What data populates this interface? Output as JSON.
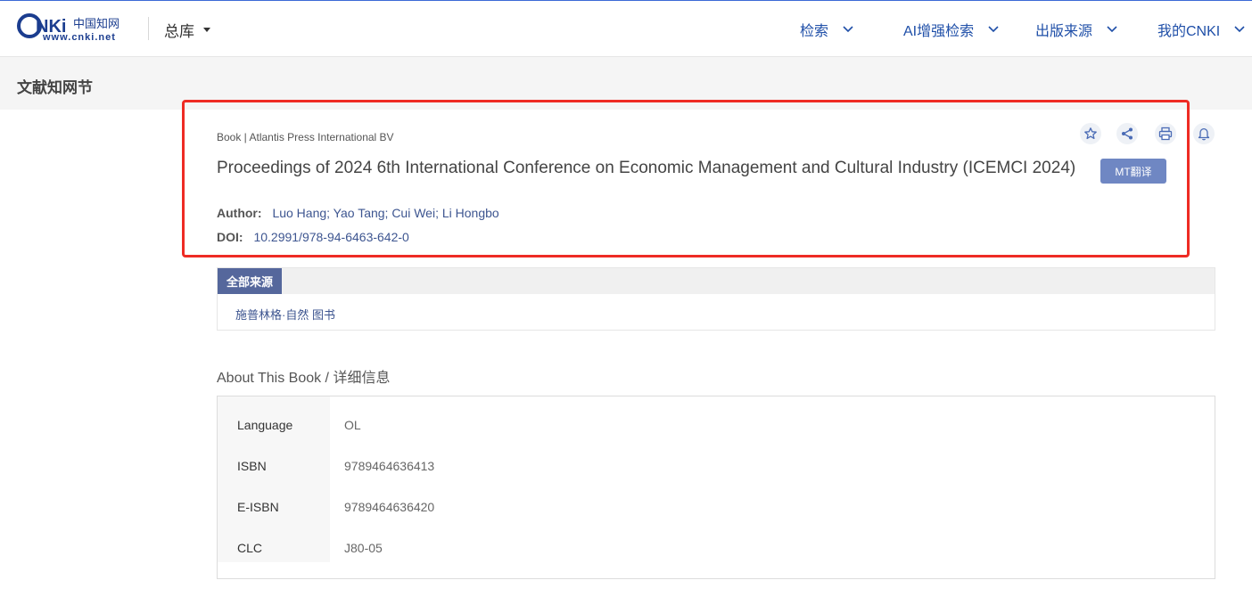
{
  "header": {
    "logo_text": "www.cnki.net",
    "library_label": "总库",
    "nav": [
      {
        "label": "检索"
      },
      {
        "label": "AI增强检索"
      },
      {
        "label": "出版来源"
      },
      {
        "label": "我的CNKI"
      }
    ]
  },
  "section": {
    "title": "文献知网节"
  },
  "book": {
    "meta": "Book | Atlantis Press International BV",
    "title": "Proceedings of 2024 6th International Conference on Economic Management and Cultural Industry (ICEMCI 2024)",
    "translate_button": "MT翻译",
    "author_label": "Author:",
    "authors": "Luo Hang; Yao Tang; Cui Wei; Li Hongbo",
    "doi_label": "DOI:",
    "doi": "10.2991/978-94-6463-642-0",
    "tools": [
      "star-icon",
      "share-icon",
      "print-icon",
      "bell-icon"
    ]
  },
  "sources": {
    "tab_label": "全部来源",
    "link": "施普林格·自然 图书"
  },
  "about": {
    "heading": "About This Book / 详细信息",
    "rows": [
      {
        "label": "Language",
        "value": "OL"
      },
      {
        "label": "ISBN",
        "value": "9789464636413"
      },
      {
        "label": "E-ISBN",
        "value": "9789464636420"
      },
      {
        "label": "CLC",
        "value": "J80-05"
      }
    ]
  },
  "colors": {
    "highlight": "#ee2b24",
    "nav_text": "#1f4fa8",
    "tab_bg": "#55679c",
    "button_bg": "#6f87c3"
  }
}
